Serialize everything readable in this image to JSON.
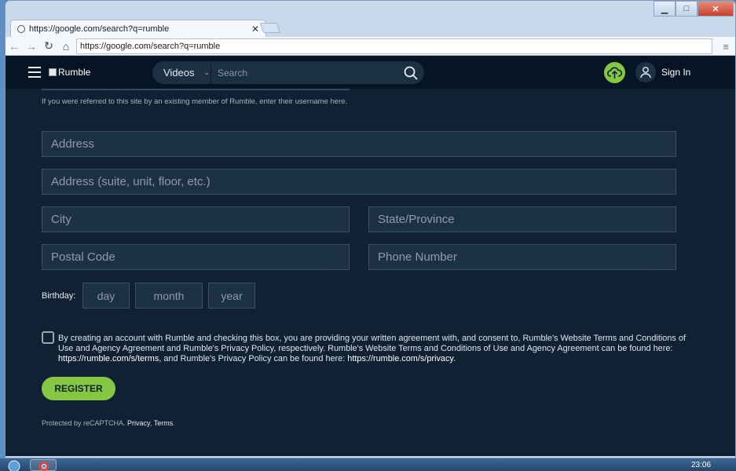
{
  "browser": {
    "tab_title": "https://google.com/search?q=rumble",
    "url": "https://google.com/search?q=rumble",
    "win_minimize": "▁",
    "win_maximize": "□",
    "win_close": "✕"
  },
  "site": {
    "logo_text": "Rumble",
    "search_category": "Videos",
    "search_placeholder": "Search",
    "sign_in": "Sign In"
  },
  "form": {
    "referral_help": "If you were referred to this site by an existing member of Rumble, enter their username here.",
    "address_placeholder": "Address",
    "address2_placeholder": "Address (suite, unit, floor, etc.)",
    "city_placeholder": "City",
    "state_placeholder": "State/Province",
    "postal_placeholder": "Postal Code",
    "phone_placeholder": "Phone Number",
    "birthday_label": "Birthday:",
    "day": "day",
    "month": "month",
    "year": "year",
    "agreement_text_1": "By creating an account with Rumble and checking this box, you are providing your written agreement with, and consent to, Rumble's Website Terms and Conditions of Use and Agency Agreement and Rumble's Privacy Policy, respectively. Rumble's Website Terms and Conditions of Use and Agency Agreement can be found here: ",
    "terms_link": "https://rumble.com/s/terms",
    "agreement_text_2": ", and Rumble's Privacy Policy can be found here: ",
    "privacy_link": "https://rumble.com/s/privacy",
    "agreement_text_3": ".",
    "register_label": "REGISTER",
    "captcha_text": "Protected by reCAPTCHA. ",
    "captcha_privacy": "Privacy",
    "captcha_sep": ", ",
    "captcha_terms": "Terms",
    "captcha_end": "."
  },
  "taskbar": {
    "time": "23:06"
  },
  "colors": {
    "accent": "#85c742",
    "page_bg": "#0f2133",
    "nav_bg": "#061523",
    "field_bg": "#1c3144"
  }
}
